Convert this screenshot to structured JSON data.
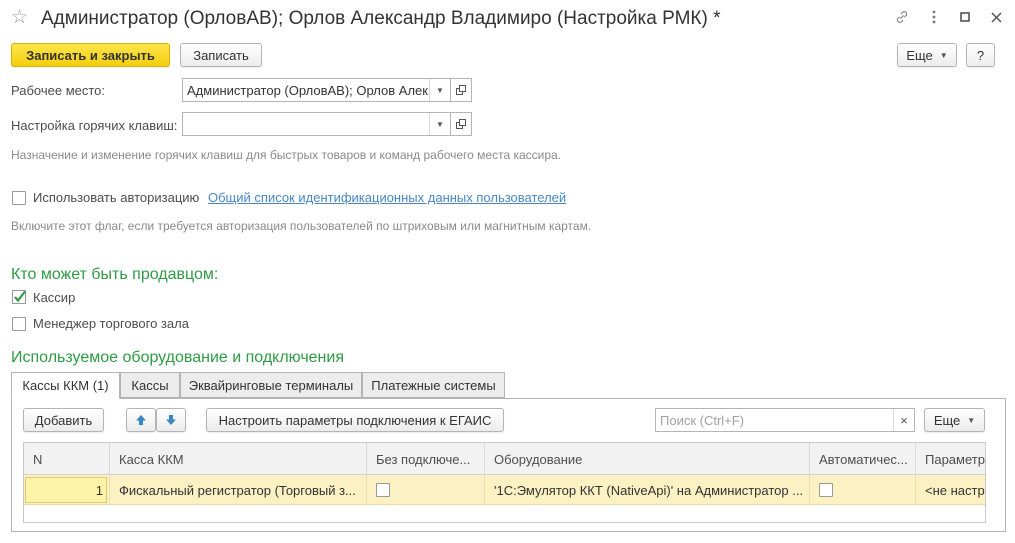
{
  "window": {
    "title": "Администратор (ОрловАВ); Орлов Александр Владимиро (Настройка РМК) *",
    "star": "☆"
  },
  "toolbar": {
    "save_close_label": "Записать и закрыть",
    "save_label": "Записать",
    "more_label": "Еще",
    "help_label": "?"
  },
  "workplace": {
    "label": "Рабочее место:",
    "value": "Администратор (ОрловАВ); Орлов Алек"
  },
  "hotkeys": {
    "label": "Настройка горячих клавиш:",
    "value": "",
    "hint": "Назначение и изменение горячих клавиш для быстрых товаров и команд рабочего места кассира."
  },
  "auth": {
    "checkbox_label": "Использовать авторизацию",
    "checked": false,
    "link_label": "Общий список идентификационных данных пользователей",
    "hint": "Включите этот флаг, если требуется авторизация пользователей по штриховым или магнитным картам."
  },
  "seller": {
    "title": "Кто может быть продавцом:",
    "options": [
      {
        "label": "Кассир",
        "checked": true
      },
      {
        "label": "Менеджер торгового зала",
        "checked": false
      }
    ]
  },
  "equipment": {
    "title": "Используемое оборудование и подключения",
    "tabs": [
      {
        "label": "Кассы ККМ (1)",
        "active": true
      },
      {
        "label": "Кассы",
        "active": false
      },
      {
        "label": "Эквайринговые терминалы",
        "active": false
      },
      {
        "label": "Платежные системы",
        "active": false
      }
    ],
    "add_label": "Добавить",
    "egais_label": "Настроить параметры подключения к ЕГАИС",
    "search_placeholder": "Поиск (Ctrl+F)",
    "search_value": "",
    "clear_label": "×",
    "more_label": "Еще"
  },
  "table": {
    "columns": [
      "N",
      "Касса ККМ",
      "Без подключе...",
      "Оборудование",
      "Автоматичес...",
      "Параметры"
    ],
    "rows": [
      {
        "n": "1",
        "kassa": "Фискальный регистратор (Торговый з...",
        "no_connection": false,
        "equipment": "'1С:Эмулятор ККТ (NativeApi)' на Администратор ...",
        "automatic": false,
        "params": "<не настр"
      }
    ]
  },
  "colors": {
    "primary_button": "#f4cf0e",
    "section_title": "#2e9b45",
    "link": "#4a86c5",
    "selected_row": "#fbf1c2",
    "check_mark": "#2e9b45",
    "arrow_button": "#3a87c8"
  }
}
